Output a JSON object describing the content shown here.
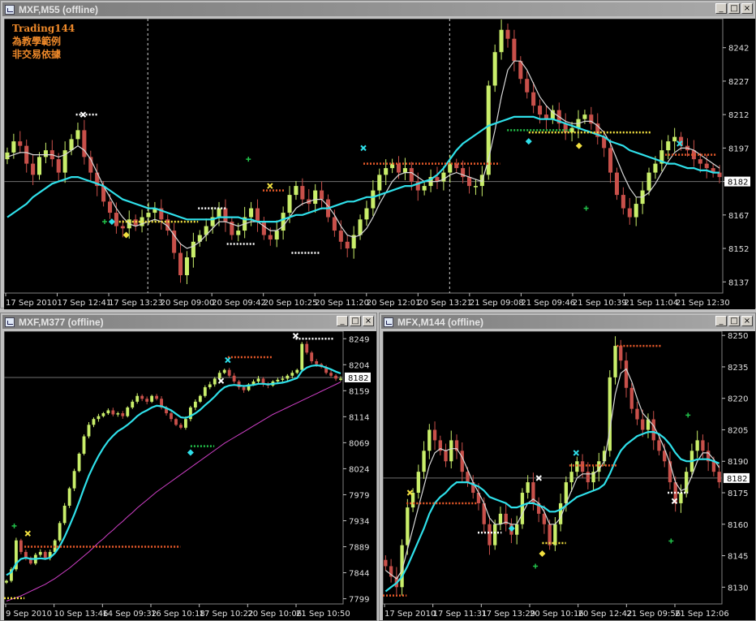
{
  "windows": [
    {
      "id": "w1",
      "title": "MXF,M55 (offline)",
      "frame": [
        0,
        0,
        932,
        380
      ],
      "plot": [
        4,
        22,
        926,
        358
      ],
      "plotW": 886,
      "ymin": 8132,
      "ymax": 8255,
      "yticks": [
        "8242",
        "8227",
        "8212",
        "8197",
        "8182",
        "8167",
        "8152",
        "8137"
      ],
      "ytickVals": [
        8242,
        8227,
        8212,
        8197,
        8182,
        8167,
        8152,
        8137
      ],
      "price_label": "8182",
      "price": 8182,
      "xticks": [
        "17 Sep 2010",
        "17 Sep 12:41",
        "17 Sep 13:23",
        "20 Sep 09:00",
        "20 Sep 09:42",
        "20 Sep 10:25",
        "20 Sep 11:20",
        "20 Sep 12:01",
        "20 Sep 13:21",
        "21 Sep 09:08",
        "21 Sep 09:46",
        "21 Sep 10:39",
        "21 Sep 11:04",
        "21 Sep 12:30"
      ],
      "notes": [
        "Trading144",
        "為教學範例",
        "非交易依據"
      ],
      "colors": {
        "up": "#c9ee6a",
        "down": "#c8504a",
        "ema": "#2fe0ea",
        "sma": "#d8d8d8",
        "slow": ""
      },
      "closes": [
        8195,
        8200,
        8198,
        8190,
        8185,
        8193,
        8196,
        8192,
        8186,
        8196,
        8201,
        8205,
        8193,
        8186,
        8180,
        8173,
        8168,
        8162,
        8161,
        8165,
        8162,
        8166,
        8168,
        8170,
        8165,
        8160,
        8150,
        8140,
        8148,
        8155,
        8158,
        8162,
        8166,
        8170,
        8164,
        8158,
        8160,
        8166,
        8170,
        8164,
        8158,
        8156,
        8160,
        8168,
        8176,
        8180,
        8174,
        8172,
        8178,
        8174,
        8166,
        8160,
        8155,
        8152,
        8158,
        8165,
        8170,
        8178,
        8185,
        8188,
        8190,
        8186,
        8188,
        8182,
        8178,
        8180,
        8184,
        8182,
        8186,
        8190,
        8188,
        8184,
        8180,
        8180,
        8185,
        8225,
        8240,
        8250,
        8246,
        8236,
        8228,
        8222,
        8216,
        8212,
        8210,
        8214,
        8208,
        8204,
        8206,
        8210,
        8212,
        8208,
        8202,
        8197,
        8186,
        8176,
        8170,
        8166,
        8172,
        8178,
        8186,
        8190,
        8196,
        8200,
        8202,
        8198,
        8196,
        8192,
        8190,
        8188,
        8186,
        8184
      ],
      "ema": [
        8166,
        8168,
        8170,
        8172,
        8175,
        8177,
        8179,
        8181,
        8182,
        8183,
        8184,
        8184,
        8183,
        8182,
        8181,
        8180,
        8178,
        8176,
        8174,
        8173,
        8172,
        8171,
        8170,
        8170,
        8169,
        8168,
        8167,
        8166,
        8165,
        8165,
        8165,
        8165,
        8165,
        8166,
        8166,
        8166,
        8166,
        8165,
        8165,
        8164,
        8164,
        8164,
        8164,
        8165,
        8166,
        8167,
        8167,
        8168,
        8169,
        8170,
        8170,
        8171,
        8172,
        8173,
        8173,
        8174,
        8175,
        8175,
        8176,
        8177,
        8178,
        8179,
        8180,
        8180,
        8181,
        8182,
        8183,
        8185,
        8188,
        8192,
        8196,
        8199,
        8201,
        8203,
        8205,
        8207,
        8208,
        8209,
        8210,
        8211,
        8211,
        8211,
        8211,
        8210,
        8210,
        8210,
        8209,
        8208,
        8207,
        8206,
        8205,
        8204,
        8203,
        8202,
        8200,
        8199,
        8198,
        8196,
        8195,
        8194,
        8193,
        8192,
        8191,
        8190,
        8190,
        8189,
        8188,
        8188,
        8187,
        8187,
        8186,
        8186
      ],
      "sma": [
        8193,
        8194,
        8195,
        8195,
        8194,
        8194,
        8194,
        8194,
        8193,
        8194,
        8196,
        8198,
        8196,
        8192,
        8186,
        8180,
        8175,
        8170,
        8166,
        8163,
        8162,
        8163,
        8164,
        8165,
        8164,
        8162,
        8158,
        8154,
        8152,
        8153,
        8155,
        8158,
        8161,
        8164,
        8164,
        8163,
        8162,
        8163,
        8164,
        8164,
        8162,
        8160,
        8160,
        8162,
        8166,
        8170,
        8172,
        8173,
        8174,
        8174,
        8171,
        8167,
        8162,
        8158,
        8157,
        8158,
        8161,
        8166,
        8172,
        8177,
        8182,
        8185,
        8186,
        8186,
        8184,
        8182,
        8182,
        8182,
        8183,
        8185,
        8186,
        8185,
        8184,
        8183,
        8182,
        8192,
        8205,
        8220,
        8232,
        8236,
        8236,
        8232,
        8226,
        8220,
        8216,
        8213,
        8211,
        8209,
        8208,
        8208,
        8209,
        8209,
        8207,
        8204,
        8199,
        8192,
        8185,
        8179,
        8175,
        8175,
        8177,
        8181,
        8186,
        8191,
        8195,
        8197,
        8197,
        8196,
        8194,
        8192,
        8190,
        8188
      ],
      "slow": [],
      "dashes": [
        0.2,
        0.62
      ],
      "levels": [
        {
          "x0": 0.1,
          "x1": 0.13,
          "y": 8212,
          "c": "#ffffff"
        },
        {
          "x0": 0.16,
          "x1": 0.27,
          "y": 8164,
          "c": "#f2e040"
        },
        {
          "x0": 0.27,
          "x1": 0.31,
          "y": 8170,
          "c": "#ffffff"
        },
        {
          "x0": 0.31,
          "x1": 0.35,
          "y": 8154,
          "c": "#ffffff"
        },
        {
          "x0": 0.36,
          "x1": 0.39,
          "y": 8178,
          "c": "#e85a2a"
        },
        {
          "x0": 0.4,
          "x1": 0.44,
          "y": 8150,
          "c": "#ffffff"
        },
        {
          "x0": 0.5,
          "x1": 0.69,
          "y": 8190,
          "c": "#e85a2a"
        },
        {
          "x0": 0.73,
          "x1": 0.9,
          "y": 8204,
          "c": "#f2e040"
        },
        {
          "x0": 0.7,
          "x1": 0.79,
          "y": 8205,
          "c": "#22c24a"
        },
        {
          "x0": 0.92,
          "x1": 0.99,
          "y": 8194,
          "c": "#e85a2a"
        }
      ],
      "markers": [
        {
          "x": 0.11,
          "y": 8212,
          "t": "x",
          "c": "#ffffff"
        },
        {
          "x": 0.15,
          "y": 8164,
          "t": "d",
          "c": "#2fe0ea"
        },
        {
          "x": 0.17,
          "y": 8158,
          "t": "d",
          "c": "#f2e040"
        },
        {
          "x": 0.37,
          "y": 8180,
          "t": "x",
          "c": "#f2e040"
        },
        {
          "x": 0.5,
          "y": 8197,
          "t": "x",
          "c": "#2fe0ea"
        },
        {
          "x": 0.73,
          "y": 8200,
          "t": "d",
          "c": "#2fe0ea"
        },
        {
          "x": 0.8,
          "y": 8198,
          "t": "d",
          "c": "#f2e040"
        },
        {
          "x": 0.94,
          "y": 8199,
          "t": "x",
          "c": "#2fe0ea"
        },
        {
          "x": 0.81,
          "y": 8170,
          "t": "+",
          "c": "#22c24a"
        },
        {
          "x": 0.34,
          "y": 8192,
          "t": "+",
          "c": "#22c24a"
        },
        {
          "x": 0.14,
          "y": 8164,
          "t": "+",
          "c": "#22c24a"
        }
      ]
    },
    {
      "id": "w2",
      "title": "MXF,M377 (offline)",
      "frame": [
        0,
        385,
        465,
        380
      ],
      "plot": [
        4,
        407,
        459,
        356
      ],
      "plotW": 418,
      "ymin": 7790,
      "ymax": 8262,
      "yticks": [
        "8249",
        "8204",
        "8159",
        "8114",
        "8069",
        "8024",
        "7979",
        "7934",
        "7889",
        "7844",
        "7799"
      ],
      "ytickVals": [
        8249,
        8204,
        8159,
        8114,
        8069,
        8024,
        7979,
        7934,
        7889,
        7844,
        7799
      ],
      "price_label": "8182",
      "price": 8182,
      "xticks": [
        "9 Sep 2010",
        "10 Sep 13:46",
        "14 Sep 09:32",
        "16 Sep 10:18",
        "17 Sep 10:22",
        "20 Sep 10:06",
        "21 Sep 10:50"
      ],
      "notes": [],
      "colors": {
        "up": "#c9ee6a",
        "down": "#c8504a",
        "ema": "#2fe0ea",
        "sma": "",
        "slow": "#d040c8"
      },
      "closes": [
        7830,
        7850,
        7900,
        7880,
        7870,
        7860,
        7875,
        7880,
        7870,
        7880,
        7900,
        7930,
        7960,
        7990,
        8020,
        8050,
        8080,
        8100,
        8110,
        8115,
        8120,
        8125,
        8118,
        8120,
        8115,
        8130,
        8140,
        8150,
        8145,
        8140,
        8150,
        8145,
        8130,
        8120,
        8110,
        8100,
        8095,
        8110,
        8130,
        8140,
        8150,
        8165,
        8170,
        8180,
        8190,
        8195,
        8185,
        8175,
        8165,
        8160,
        8170,
        8175,
        8180,
        8170,
        8168,
        8175,
        8178,
        8180,
        8185,
        8190,
        8195,
        8240,
        8225,
        8210,
        8205,
        8200,
        8190,
        8185,
        8180,
        8180
      ],
      "ema": [
        7840,
        7845,
        7860,
        7868,
        7870,
        7868,
        7868,
        7869,
        7868,
        7870,
        7878,
        7890,
        7906,
        7925,
        7945,
        7967,
        7990,
        8012,
        8030,
        8046,
        8060,
        8072,
        8081,
        8089,
        8094,
        8100,
        8107,
        8115,
        8121,
        8125,
        8130,
        8133,
        8132,
        8129,
        8125,
        8119,
        8113,
        8112,
        8115,
        8120,
        8126,
        8134,
        8141,
        8149,
        8158,
        8165,
        8168,
        8169,
        8168,
        8167,
        8168,
        8169,
        8171,
        8171,
        8170,
        8171,
        8172,
        8173,
        8175,
        8178,
        8181,
        8193,
        8199,
        8202,
        8203,
        8202,
        8199,
        8196,
        8192,
        8189
      ],
      "sma": [],
      "slow": [
        7795,
        7798,
        7801,
        7804,
        7808,
        7812,
        7816,
        7820,
        7824,
        7829,
        7834,
        7840,
        7846,
        7852,
        7859,
        7866,
        7873,
        7880,
        7888,
        7896,
        7903,
        7911,
        7918,
        7926,
        7933,
        7941,
        7948,
        7956,
        7963,
        7970,
        7977,
        7984,
        7990,
        7996,
        8002,
        8008,
        8014,
        8020,
        8026,
        8032,
        8038,
        8044,
        8050,
        8056,
        8062,
        8068,
        8073,
        8078,
        8083,
        8088,
        8093,
        8098,
        8103,
        8108,
        8113,
        8118,
        8122,
        8126,
        8130,
        8134,
        8138,
        8142,
        8146,
        8150,
        8154,
        8158,
        8162,
        8166,
        8170,
        8174
      ],
      "dashes": [],
      "levels": [
        {
          "x0": 0.0,
          "x1": 0.06,
          "y": 7800,
          "c": "#f2e040"
        },
        {
          "x0": 0.06,
          "x1": 0.52,
          "y": 7889,
          "c": "#e85a2a"
        },
        {
          "x0": 0.55,
          "x1": 0.62,
          "y": 8063,
          "c": "#22c24a"
        },
        {
          "x0": 0.66,
          "x1": 0.79,
          "y": 8217,
          "c": "#e85a2a"
        },
        {
          "x0": 0.86,
          "x1": 0.97,
          "y": 8249,
          "c": "#ffffff"
        }
      ],
      "markers": [
        {
          "x": 0.07,
          "y": 7912,
          "t": "x",
          "c": "#f2e040"
        },
        {
          "x": 0.55,
          "y": 8052,
          "t": "d",
          "c": "#2fe0ea"
        },
        {
          "x": 0.66,
          "y": 8212,
          "t": "x",
          "c": "#2fe0ea"
        },
        {
          "x": 0.86,
          "y": 8254,
          "t": "x",
          "c": "#ffffff"
        },
        {
          "x": 0.64,
          "y": 8176,
          "t": "x",
          "c": "#ffffff"
        },
        {
          "x": 0.03,
          "y": 7925,
          "t": "+",
          "c": "#22c24a"
        }
      ]
    },
    {
      "id": "w3",
      "title": "MFX,M144 (offline)",
      "frame": [
        467,
        385,
        465,
        380
      ],
      "plot": [
        471,
        407,
        459,
        356
      ],
      "plotW": 418,
      "ymin": 8122,
      "ymax": 8252,
      "yticks": [
        "8250",
        "8235",
        "8220",
        "8205",
        "8190",
        "8175",
        "8160",
        "8145",
        "8130"
      ],
      "ytickVals": [
        8250,
        8235,
        8220,
        8205,
        8190,
        8175,
        8160,
        8145,
        8130
      ],
      "price_label": "8182",
      "price": 8182,
      "xticks": [
        "17 Sep 2010",
        "17 Sep 11:31",
        "17 Sep 13:29",
        "20 Sep 10:16",
        "20 Sep 12:42",
        "21 Sep 09:56",
        "21 Sep 12:06"
      ],
      "notes": [],
      "colors": {
        "up": "#c9ee6a",
        "down": "#c8504a",
        "ema": "#2fe0ea",
        "sma": "#d8d8d8",
        "slow": ""
      },
      "closes": [
        8140,
        8135,
        8130,
        8150,
        8168,
        8175,
        8185,
        8195,
        8205,
        8200,
        8195,
        8190,
        8200,
        8195,
        8185,
        8180,
        8175,
        8170,
        8160,
        8150,
        8160,
        8165,
        8160,
        8155,
        8160,
        8175,
        8180,
        8170,
        8165,
        8160,
        8150,
        8160,
        8170,
        8180,
        8185,
        8190,
        8185,
        8180,
        8185,
        8190,
        8195,
        8230,
        8245,
        8238,
        8225,
        8215,
        8210,
        8205,
        8210,
        8200,
        8195,
        8190,
        8180,
        8170,
        8175,
        8185,
        8195,
        8200,
        8195,
        8190,
        8185,
        8180
      ],
      "ema": [
        8128,
        8130,
        8132,
        8135,
        8140,
        8146,
        8152,
        8158,
        8165,
        8170,
        8173,
        8175,
        8178,
        8180,
        8180,
        8180,
        8179,
        8178,
        8176,
        8173,
        8172,
        8171,
        8170,
        8168,
        8168,
        8169,
        8170,
        8170,
        8169,
        8168,
        8166,
        8166,
        8167,
        8169,
        8171,
        8173,
        8174,
        8175,
        8176,
        8177,
        8179,
        8184,
        8190,
        8195,
        8198,
        8200,
        8202,
        8203,
        8204,
        8204,
        8203,
        8201,
        8198,
        8194,
        8191,
        8190,
        8190,
        8191,
        8191,
        8191,
        8190,
        8189
      ],
      "sma": [
        8138,
        8136,
        8134,
        8138,
        8148,
        8158,
        8168,
        8178,
        8188,
        8194,
        8196,
        8195,
        8196,
        8196,
        8192,
        8186,
        8180,
        8175,
        8170,
        8163,
        8160,
        8160,
        8161,
        8160,
        8160,
        8165,
        8170,
        8172,
        8170,
        8166,
        8160,
        8160,
        8163,
        8170,
        8176,
        8182,
        8184,
        8184,
        8184,
        8186,
        8190,
        8205,
        8222,
        8232,
        8234,
        8228,
        8220,
        8213,
        8210,
        8207,
        8202,
        8196,
        8189,
        8180,
        8176,
        8177,
        8183,
        8190,
        8194,
        8194,
        8191,
        8187
      ],
      "slow": [],
      "dashes": [],
      "levels": [
        {
          "x0": 0.0,
          "x1": 0.07,
          "y": 8126,
          "c": "#e85a2a"
        },
        {
          "x0": 0.07,
          "x1": 0.28,
          "y": 8170,
          "c": "#e85a2a"
        },
        {
          "x0": 0.28,
          "x1": 0.35,
          "y": 8156,
          "c": "#ffffff"
        },
        {
          "x0": 0.47,
          "x1": 0.54,
          "y": 8151,
          "c": "#f2e040"
        },
        {
          "x0": 0.55,
          "x1": 0.69,
          "y": 8188,
          "c": "#e85a2a"
        },
        {
          "x0": 0.69,
          "x1": 0.82,
          "y": 8245,
          "c": "#e85a2a"
        },
        {
          "x0": 0.84,
          "x1": 0.9,
          "y": 8175,
          "c": "#ffffff"
        }
      ],
      "markers": [
        {
          "x": 0.08,
          "y": 8175,
          "t": "x",
          "c": "#f2e040"
        },
        {
          "x": 0.47,
          "y": 8146,
          "t": "d",
          "c": "#f2e040"
        },
        {
          "x": 0.57,
          "y": 8194,
          "t": "x",
          "c": "#2fe0ea"
        },
        {
          "x": 0.46,
          "y": 8182,
          "t": "x",
          "c": "#ffffff"
        },
        {
          "x": 0.86,
          "y": 8171,
          "t": "x",
          "c": "#ffffff"
        },
        {
          "x": 0.38,
          "y": 8158,
          "t": "d",
          "c": "#2fe0ea"
        },
        {
          "x": 0.45,
          "y": 8140,
          "t": "+",
          "c": "#22c24a"
        },
        {
          "x": 0.9,
          "y": 8212,
          "t": "+",
          "c": "#22c24a"
        },
        {
          "x": 0.85,
          "y": 8152,
          "t": "+",
          "c": "#22c24a"
        }
      ]
    }
  ]
}
